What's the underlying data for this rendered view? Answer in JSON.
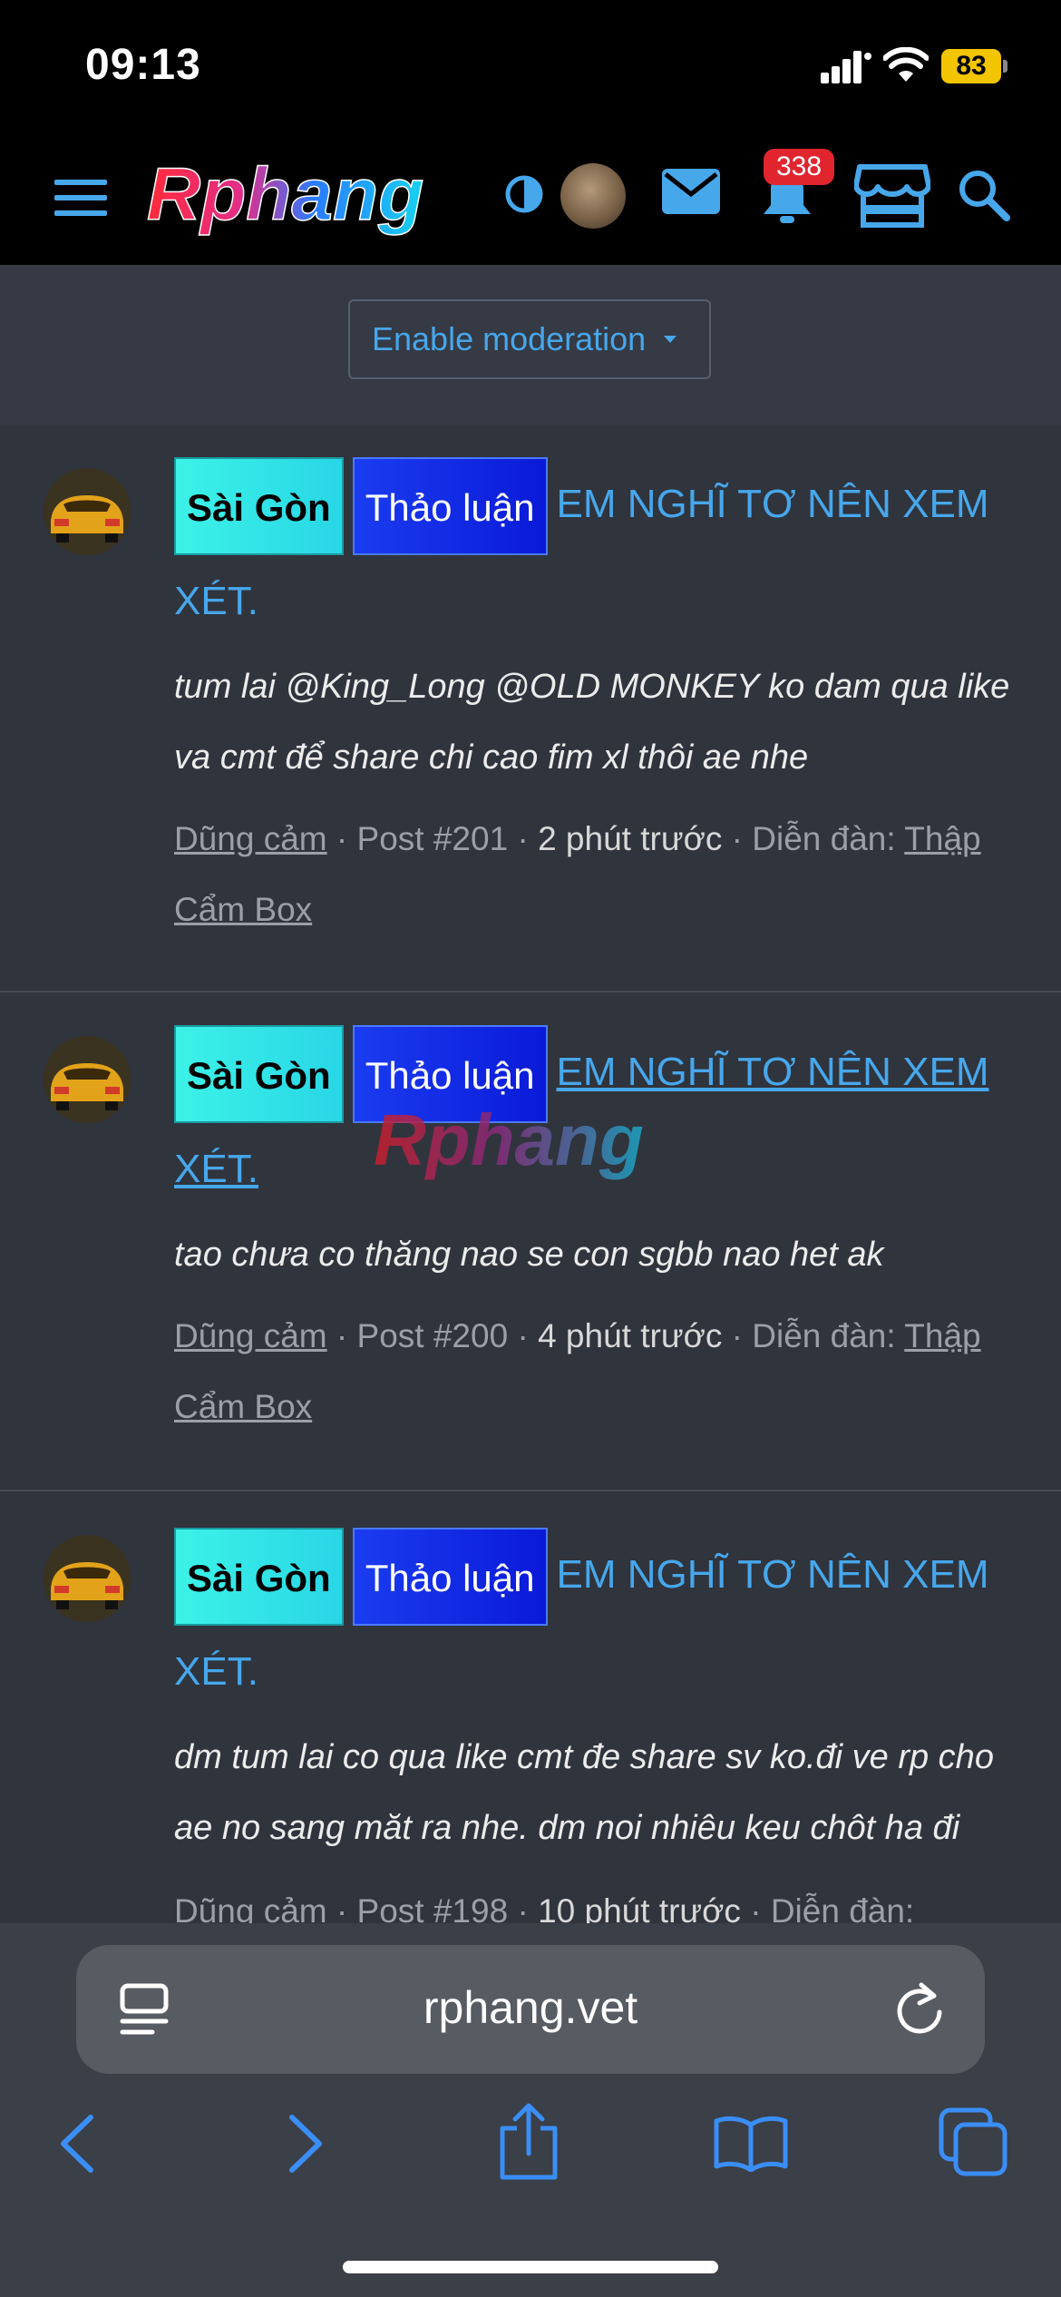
{
  "status_bar": {
    "time": "09:13",
    "battery": "83"
  },
  "header": {
    "logo_text": "Rphang",
    "notification_count": "338"
  },
  "moderation": {
    "button_label": "Enable moderation"
  },
  "posts": [
    {
      "tag1": "Sài Gòn",
      "tag2": "Thảo luận",
      "title_first": "EM NGHĨ TƠ NÊN XEM",
      "title_rest": "XÉT.",
      "snippet_l1": "tum lai @King_Long @OLD MONKEY ko dam qua like",
      "snippet_l2": "va cmt để share chi cao fim xl thôi ae nhe",
      "author": "Dũng cảm",
      "post_no": "Post #201",
      "time": "2 phút trước",
      "forum_label": "Diễn đàn:",
      "forum_l1": "Thập",
      "forum_l2": "Cẩm Box"
    },
    {
      "tag1": "Sài Gòn",
      "tag2": "Thảo luận",
      "title_first": "EM NGHĨ TƠ NÊN XEM",
      "title_rest": "XÉT.",
      "snippet_l1": "tao chưa co thăng nao se con sgbb nao het ak",
      "author": "Dũng cảm",
      "post_no": "Post #200",
      "time": "4 phút trước",
      "forum_label": "Diễn đàn:",
      "forum_l1": "Thập",
      "forum_l2": "Cẩm Box"
    },
    {
      "tag1": "Sài Gòn",
      "tag2": "Thảo luận",
      "title_first": "EM NGHĨ TƠ NÊN XEM",
      "title_rest": "XÉT.",
      "snippet_l1": "dm tum lai co qua like cmt đe share sv ko.đi ve rp cho",
      "snippet_l2": "ae no sang măt ra nhe. dm noi nhiêu keu chôt ha đi",
      "author": "Dũng cảm",
      "post_no": "Post #198",
      "time": "10 phút trước",
      "forum_label": "Diễn đàn:"
    }
  ],
  "watermark": "Rphang",
  "browser": {
    "url": "rphang.vet"
  },
  "colors": {
    "link": "#47a7eb",
    "background": "#30343d",
    "badge": "#e0252e"
  }
}
